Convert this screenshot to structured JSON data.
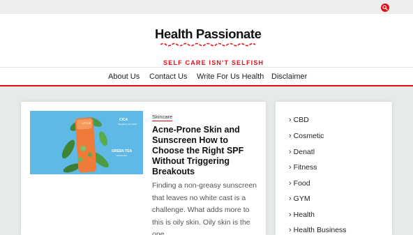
{
  "site": {
    "title": "Health Passionate",
    "tagline": "SELF CARE ISN'T SELFISH",
    "accent_color": "#e10c18"
  },
  "topbar": {
    "search_icon": "search-icon"
  },
  "nav": {
    "items": [
      {
        "label": "About Us"
      },
      {
        "label": "Contact Us"
      },
      {
        "label": "Write For Us Health"
      },
      {
        "label": "Disclaimer"
      }
    ]
  },
  "post": {
    "category": "Skincare",
    "title": "Acne-Prone Skin and Sunscreen How to Choose the Right SPF Without Triggering Breakouts",
    "excerpt": "Finding a non-greasy sunscreen that leaves no white cast is a challenge. What adds more to this is oily skin. Oily skin is the one",
    "image": {
      "brand": "LOTUS",
      "label_top": "CICA",
      "label_top_sub": "Strengthens skin barrier",
      "label_bottom": "GREEN TEA",
      "label_bottom_sub": "Soothes skin"
    }
  },
  "sidebar": {
    "items": [
      {
        "label": "CBD"
      },
      {
        "label": "Cosmetic"
      },
      {
        "label": "Denatl"
      },
      {
        "label": "Fitness"
      },
      {
        "label": "Food"
      },
      {
        "label": "GYM"
      },
      {
        "label": "Health"
      },
      {
        "label": "Health Business"
      }
    ]
  }
}
